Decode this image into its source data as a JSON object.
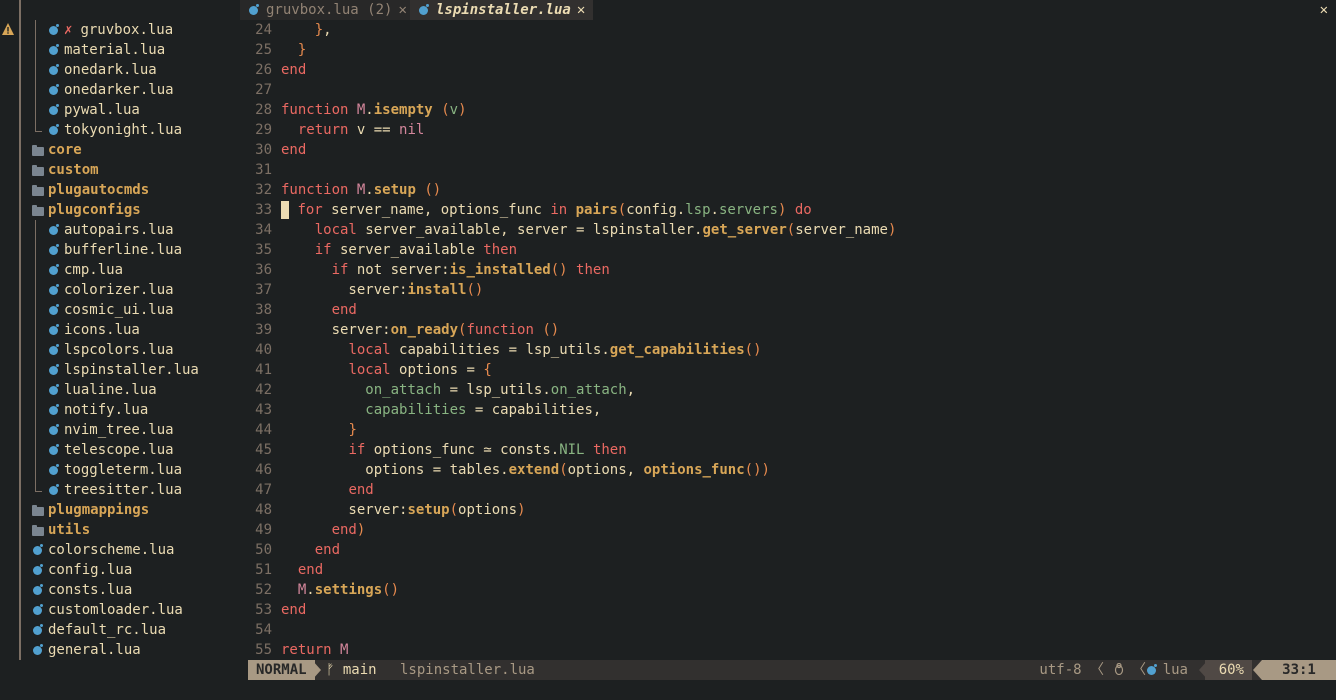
{
  "tabs": [
    {
      "label": "gruvbox.lua (2)",
      "close": "✕",
      "active": false
    },
    {
      "label": "lspinstaller.lua",
      "close": "✕",
      "active": true
    }
  ],
  "window_close": "✕",
  "sidebar": {
    "items": [
      {
        "label": "gruvbox.lua",
        "type": "file",
        "depth": 1,
        "error": "✗",
        "guide": "mid"
      },
      {
        "label": "material.lua",
        "type": "file",
        "depth": 1,
        "guide": "mid"
      },
      {
        "label": "onedark.lua",
        "type": "file",
        "depth": 1,
        "guide": "mid"
      },
      {
        "label": "onedarker.lua",
        "type": "file",
        "depth": 1,
        "guide": "mid"
      },
      {
        "label": "pywal.lua",
        "type": "file",
        "depth": 1,
        "guide": "mid"
      },
      {
        "label": "tokyonight.lua",
        "type": "file",
        "depth": 1,
        "guide": "end"
      },
      {
        "label": "core",
        "type": "folder",
        "depth": 0
      },
      {
        "label": "custom",
        "type": "folder",
        "depth": 0
      },
      {
        "label": "plugautocmds",
        "type": "folder",
        "depth": 0
      },
      {
        "label": "plugconfigs",
        "type": "folder",
        "depth": 0
      },
      {
        "label": "autopairs.lua",
        "type": "file",
        "depth": 1,
        "guide": "mid"
      },
      {
        "label": "bufferline.lua",
        "type": "file",
        "depth": 1,
        "guide": "mid"
      },
      {
        "label": "cmp.lua",
        "type": "file",
        "depth": 1,
        "guide": "mid"
      },
      {
        "label": "colorizer.lua",
        "type": "file",
        "depth": 1,
        "guide": "mid"
      },
      {
        "label": "cosmic_ui.lua",
        "type": "file",
        "depth": 1,
        "guide": "mid"
      },
      {
        "label": "icons.lua",
        "type": "file",
        "depth": 1,
        "guide": "mid"
      },
      {
        "label": "lspcolors.lua",
        "type": "file",
        "depth": 1,
        "guide": "mid"
      },
      {
        "label": "lspinstaller.lua",
        "type": "file",
        "depth": 1,
        "guide": "mid"
      },
      {
        "label": "lualine.lua",
        "type": "file",
        "depth": 1,
        "guide": "mid"
      },
      {
        "label": "notify.lua",
        "type": "file",
        "depth": 1,
        "guide": "mid"
      },
      {
        "label": "nvim_tree.lua",
        "type": "file",
        "depth": 1,
        "guide": "mid"
      },
      {
        "label": "telescope.lua",
        "type": "file",
        "depth": 1,
        "guide": "mid"
      },
      {
        "label": "toggleterm.lua",
        "type": "file",
        "depth": 1,
        "guide": "mid"
      },
      {
        "label": "treesitter.lua",
        "type": "file",
        "depth": 1,
        "guide": "end"
      },
      {
        "label": "plugmappings",
        "type": "folder",
        "depth": 0
      },
      {
        "label": "utils",
        "type": "folder",
        "depth": 0
      },
      {
        "label": "colorscheme.lua",
        "type": "file",
        "depth": 0
      },
      {
        "label": "config.lua",
        "type": "file",
        "depth": 0
      },
      {
        "label": "consts.lua",
        "type": "file",
        "depth": 0
      },
      {
        "label": "customloader.lua",
        "type": "file",
        "depth": 0
      },
      {
        "label": "default_rc.lua",
        "type": "file",
        "depth": 0
      },
      {
        "label": "general.lua",
        "type": "file",
        "depth": 0
      }
    ]
  },
  "editor": {
    "lines": [
      {
        "n": "24",
        "tokens": [
          [
            "    ",
            "t-id"
          ],
          [
            "}",
            "t-par"
          ],
          [
            ",",
            "t-op"
          ]
        ]
      },
      {
        "n": "25",
        "tokens": [
          [
            "  ",
            "t-id"
          ],
          [
            "}",
            "t-par"
          ]
        ]
      },
      {
        "n": "26",
        "tokens": [
          [
            "end",
            "t-kw"
          ]
        ]
      },
      {
        "n": "27",
        "tokens": []
      },
      {
        "n": "28",
        "tokens": [
          [
            "function ",
            "t-kw"
          ],
          [
            "M",
            "t-m"
          ],
          [
            ".",
            "t-op"
          ],
          [
            "isempty",
            "t-fn"
          ],
          [
            " ",
            "t-id"
          ],
          [
            "(",
            "t-par"
          ],
          [
            "v",
            "t-field"
          ],
          [
            ")",
            "t-par"
          ]
        ]
      },
      {
        "n": "29",
        "tokens": [
          [
            "  ",
            "t-id"
          ],
          [
            "return",
            "t-kw"
          ],
          [
            " v ",
            "t-id"
          ],
          [
            "==",
            "t-op"
          ],
          [
            " ",
            "t-id"
          ],
          [
            "nil",
            "t-nil"
          ]
        ]
      },
      {
        "n": "30",
        "tokens": [
          [
            "end",
            "t-kw"
          ]
        ]
      },
      {
        "n": "31",
        "tokens": []
      },
      {
        "n": "32",
        "tokens": [
          [
            "function ",
            "t-kw"
          ],
          [
            "M",
            "t-m"
          ],
          [
            ".",
            "t-op"
          ],
          [
            "setup",
            "t-fn"
          ],
          [
            " ",
            "t-id"
          ],
          [
            "()",
            "t-par"
          ]
        ]
      },
      {
        "n": "33",
        "cursor": true,
        "tokens": [
          [
            "for",
            "t-kw"
          ],
          [
            " server_name, options_func ",
            "t-id"
          ],
          [
            "in",
            "t-kw"
          ],
          [
            " ",
            "t-id"
          ],
          [
            "pairs",
            "t-fn"
          ],
          [
            "(",
            "t-par"
          ],
          [
            "config",
            "t-id"
          ],
          [
            ".",
            "t-op"
          ],
          [
            "lsp",
            "t-field"
          ],
          [
            ".",
            "t-op"
          ],
          [
            "servers",
            "t-field"
          ],
          [
            ")",
            "t-par"
          ],
          [
            " ",
            "t-id"
          ],
          [
            "do",
            "t-kw"
          ]
        ]
      },
      {
        "n": "34",
        "tokens": [
          [
            "    ",
            "t-id"
          ],
          [
            "local",
            "t-kw"
          ],
          [
            " server_available, server ",
            "t-id"
          ],
          [
            "=",
            "t-op"
          ],
          [
            " lspinstaller",
            "t-id"
          ],
          [
            ".",
            "t-op"
          ],
          [
            "get_server",
            "t-fn"
          ],
          [
            "(",
            "t-par"
          ],
          [
            "server_name",
            "t-id"
          ],
          [
            ")",
            "t-par"
          ]
        ]
      },
      {
        "n": "35",
        "tokens": [
          [
            "    ",
            "t-id"
          ],
          [
            "if",
            "t-kw"
          ],
          [
            " server_available ",
            "t-id"
          ],
          [
            "then",
            "t-kw"
          ]
        ]
      },
      {
        "n": "36",
        "tokens": [
          [
            "      ",
            "t-id"
          ],
          [
            "if",
            "t-kw"
          ],
          [
            " not server",
            "t-id"
          ],
          [
            ":",
            "t-op"
          ],
          [
            "is_installed",
            "t-fn"
          ],
          [
            "()",
            "t-par"
          ],
          [
            " ",
            "t-id"
          ],
          [
            "then",
            "t-kw"
          ]
        ]
      },
      {
        "n": "37",
        "tokens": [
          [
            "        server",
            "t-id"
          ],
          [
            ":",
            "t-op"
          ],
          [
            "install",
            "t-fn"
          ],
          [
            "()",
            "t-par"
          ]
        ]
      },
      {
        "n": "38",
        "tokens": [
          [
            "      ",
            "t-id"
          ],
          [
            "end",
            "t-kw"
          ]
        ]
      },
      {
        "n": "39",
        "tokens": [
          [
            "      server",
            "t-id"
          ],
          [
            ":",
            "t-op"
          ],
          [
            "on_ready",
            "t-fn"
          ],
          [
            "(",
            "t-par"
          ],
          [
            "function",
            "t-kw"
          ],
          [
            " ",
            "t-id"
          ],
          [
            "()",
            "t-par"
          ]
        ]
      },
      {
        "n": "40",
        "tokens": [
          [
            "        ",
            "t-id"
          ],
          [
            "local",
            "t-kw"
          ],
          [
            " capabilities ",
            "t-id"
          ],
          [
            "=",
            "t-op"
          ],
          [
            " lsp_utils",
            "t-id"
          ],
          [
            ".",
            "t-op"
          ],
          [
            "get_capabilities",
            "t-fn"
          ],
          [
            "()",
            "t-par"
          ]
        ]
      },
      {
        "n": "41",
        "tokens": [
          [
            "        ",
            "t-id"
          ],
          [
            "local",
            "t-kw"
          ],
          [
            " options ",
            "t-id"
          ],
          [
            "=",
            "t-op"
          ],
          [
            " ",
            "t-id"
          ],
          [
            "{",
            "t-par"
          ]
        ]
      },
      {
        "n": "42",
        "tokens": [
          [
            "          ",
            "t-id"
          ],
          [
            "on_attach",
            "t-field"
          ],
          [
            " ",
            "t-id"
          ],
          [
            "=",
            "t-op"
          ],
          [
            " lsp_utils",
            "t-id"
          ],
          [
            ".",
            "t-op"
          ],
          [
            "on_attach",
            "t-field"
          ],
          [
            ",",
            "t-op"
          ]
        ]
      },
      {
        "n": "43",
        "tokens": [
          [
            "          ",
            "t-id"
          ],
          [
            "capabilities",
            "t-field"
          ],
          [
            " ",
            "t-id"
          ],
          [
            "=",
            "t-op"
          ],
          [
            " capabilities",
            "t-id"
          ],
          [
            ",",
            "t-op"
          ]
        ]
      },
      {
        "n": "44",
        "tokens": [
          [
            "        ",
            "t-id"
          ],
          [
            "}",
            "t-par"
          ]
        ]
      },
      {
        "n": "45",
        "tokens": [
          [
            "        ",
            "t-id"
          ],
          [
            "if",
            "t-kw"
          ],
          [
            " options_func ",
            "t-id"
          ],
          [
            "≃",
            "t-op"
          ],
          [
            " consts",
            "t-id"
          ],
          [
            ".",
            "t-op"
          ],
          [
            "NIL",
            "t-field"
          ],
          [
            " ",
            "t-id"
          ],
          [
            "then",
            "t-kw"
          ]
        ]
      },
      {
        "n": "46",
        "tokens": [
          [
            "          options ",
            "t-id"
          ],
          [
            "=",
            "t-op"
          ],
          [
            " tables",
            "t-id"
          ],
          [
            ".",
            "t-op"
          ],
          [
            "extend",
            "t-fn"
          ],
          [
            "(",
            "t-par"
          ],
          [
            "options",
            "t-id"
          ],
          [
            ", ",
            "t-op"
          ],
          [
            "options_func",
            "t-fn"
          ],
          [
            "())",
            "t-par"
          ]
        ]
      },
      {
        "n": "47",
        "tokens": [
          [
            "        ",
            "t-id"
          ],
          [
            "end",
            "t-kw"
          ]
        ]
      },
      {
        "n": "48",
        "tokens": [
          [
            "        server",
            "t-id"
          ],
          [
            ":",
            "t-op"
          ],
          [
            "setup",
            "t-fn"
          ],
          [
            "(",
            "t-par"
          ],
          [
            "options",
            "t-id"
          ],
          [
            ")",
            "t-par"
          ]
        ]
      },
      {
        "n": "49",
        "tokens": [
          [
            "      ",
            "t-id"
          ],
          [
            "end",
            "t-kw"
          ],
          [
            ")",
            "t-par"
          ]
        ]
      },
      {
        "n": "50",
        "tokens": [
          [
            "    ",
            "t-id"
          ],
          [
            "end",
            "t-kw"
          ]
        ]
      },
      {
        "n": "51",
        "tokens": [
          [
            "  ",
            "t-id"
          ],
          [
            "end",
            "t-kw"
          ]
        ]
      },
      {
        "n": "52",
        "tokens": [
          [
            "  ",
            "t-id"
          ],
          [
            "M",
            "t-m"
          ],
          [
            ".",
            "t-op"
          ],
          [
            "settings",
            "t-fn"
          ],
          [
            "()",
            "t-par"
          ]
        ]
      },
      {
        "n": "53",
        "tokens": [
          [
            "end",
            "t-kw"
          ]
        ]
      },
      {
        "n": "54",
        "tokens": []
      },
      {
        "n": "55",
        "tokens": [
          [
            "return",
            "t-kw"
          ],
          [
            " ",
            "t-id"
          ],
          [
            "M",
            "t-m"
          ]
        ]
      }
    ]
  },
  "statusline": {
    "mode": "NORMAL",
    "branch": "main",
    "branch_icon": "ᚠ",
    "filename": "lspinstaller.lua",
    "encoding": "utf-8",
    "os_icon": "tux-icon",
    "filetype": "lua",
    "progress": "60%",
    "position": "33:1",
    "sep_left": "〈",
    "sep_right": "〈"
  },
  "colors": {
    "background": "#1d2021",
    "keyword": "#ea6962",
    "function": "#d8a657",
    "lua_icon": "#51a0cf",
    "folder": "#d8a657",
    "warning": "#d8a657"
  }
}
